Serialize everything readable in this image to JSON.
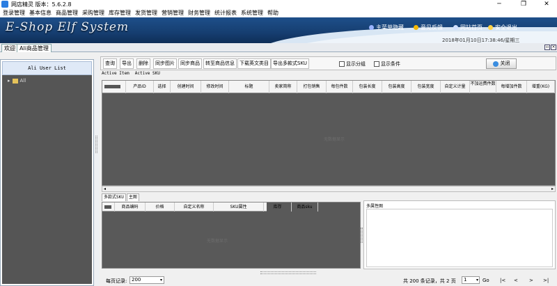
{
  "window": {
    "title": "网店精灵  版本：5.6.2.8",
    "min": "─",
    "max": "❐",
    "close": "✕"
  },
  "menu": [
    "登录管理",
    "基本信息",
    "商品管理",
    "采购管理",
    "库存管理",
    "发货管理",
    "营销管理",
    "财务管理",
    "统计报表",
    "系统管理",
    "帮助"
  ],
  "banner": {
    "logo": "E-Shop Elf System",
    "nav": [
      "主菜单隐藏",
      "意见反馈",
      "网站首页",
      "安全退出"
    ],
    "datetime": "2018年01月10日17:38:46/星期三"
  },
  "tabs": [
    "欢迎",
    "Ali商品管理"
  ],
  "left": {
    "header": "Ali User List",
    "tree_root": "All"
  },
  "toolbar": {
    "buttons": [
      "查询",
      "导出",
      "删除",
      "同步图片",
      "同步商品",
      "转至商品信息",
      "下载英文类目",
      "导出多款式SKU"
    ],
    "checks": [
      "显示分组",
      "显示条件"
    ],
    "close": "关闭"
  },
  "subtabs": [
    "Active Item",
    "Active SKU"
  ],
  "grid_main": {
    "columns": [
      "产品ID",
      "选择",
      "创建时间",
      "修改时间",
      "标题",
      "卖家简称",
      "打包销售",
      "每包件数",
      "包装长度",
      "包装高度",
      "包装宽度",
      "自定义计量",
      "不加运费件数",
      "每增加件数",
      "增重(KG)"
    ],
    "empty": "无数据显示"
  },
  "bottom_tabs": [
    "多款式SKU",
    "主图"
  ],
  "grid_sku": {
    "columns": [
      "商品编码",
      "价格",
      "自定义名称",
      "SKU属性",
      "库存",
      "商品sku"
    ],
    "empty": "无数据显示"
  },
  "images_label": "多属性图",
  "footer": {
    "per_page_label": "每页记录:",
    "per_page": "200",
    "total": "共 200 条记录，共 2 页",
    "page": "1",
    "go": "Go",
    "nav": [
      "|<",
      "<",
      ">",
      ">|"
    ]
  }
}
